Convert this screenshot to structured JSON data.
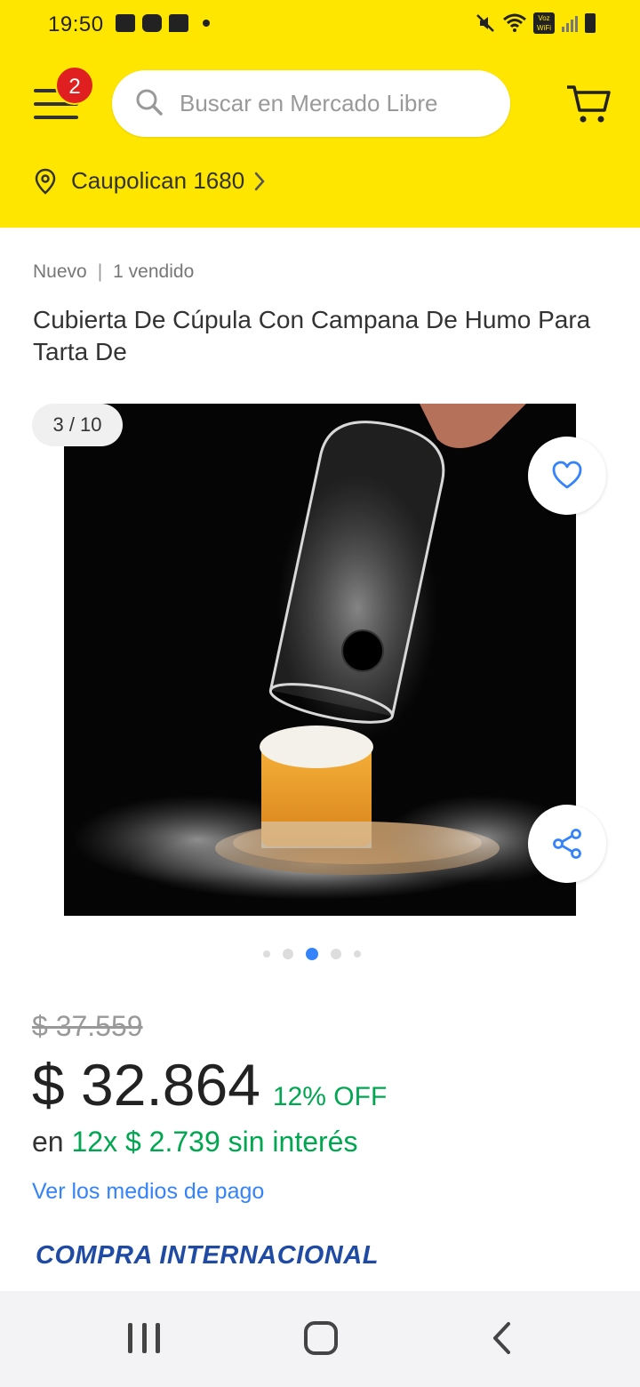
{
  "status_bar": {
    "time": "19:50",
    "left_icons": [
      "gallery-icon",
      "youtube-icon",
      "message-icon",
      "dot-icon"
    ],
    "right_icons": [
      "mute-icon",
      "wifi-icon",
      "voz-wifi-icon",
      "signal-icon",
      "battery-icon"
    ],
    "voz_label": "Voz\nWiFi"
  },
  "header": {
    "menu_badge": "2",
    "search_placeholder": "Buscar en Mercado Libre",
    "location": "Caupolican 1680",
    "accent_color": "#ffe600"
  },
  "product": {
    "condition": "Nuevo",
    "sold": "1 vendido",
    "title": "Cubierta De Cúpula Con Campana De Humo Para Tarta De",
    "image_counter": "3 / 10",
    "gallery_dots": 5,
    "gallery_active_dot": 3,
    "old_price": "$ 37.559",
    "price": "$ 32.864",
    "discount": "12% OFF",
    "installments_prefix": "en",
    "installments_value": "12x $ 2.739 sin interés",
    "payment_link": "Ver los medios de pago",
    "international_label": "COMPRA INTERNACIONAL"
  },
  "colors": {
    "green": "#00a650",
    "link_blue": "#3483fa",
    "intl_blue": "#1f4ba5",
    "badge_red": "#e02020"
  },
  "navbar": {
    "buttons": [
      "recent-apps",
      "home",
      "back"
    ]
  }
}
